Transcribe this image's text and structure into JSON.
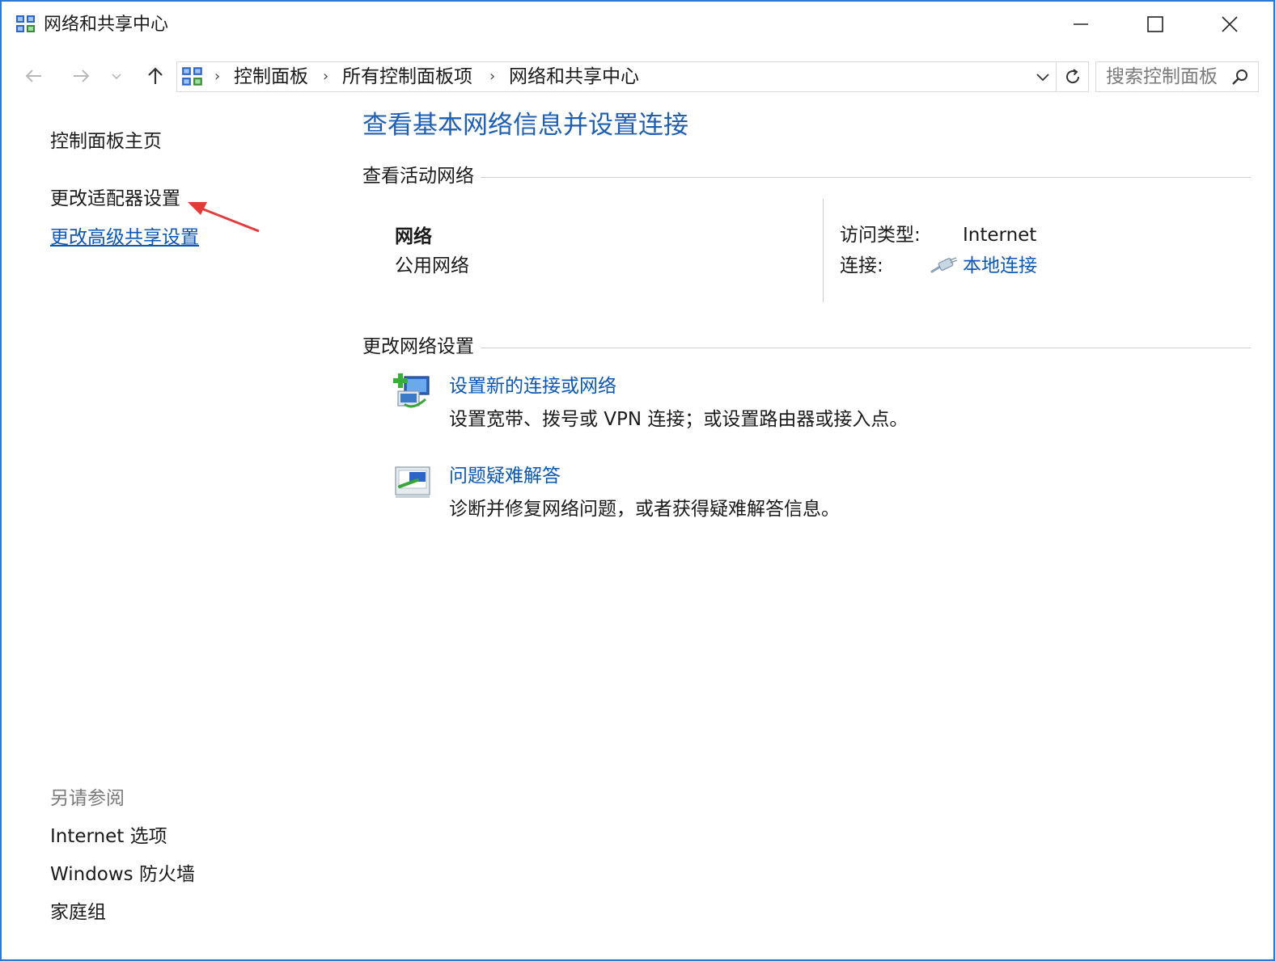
{
  "window": {
    "title": "网络和共享中心"
  },
  "address_bar": {
    "breadcrumbs": [
      "控制面板",
      "所有控制面板项",
      "网络和共享中心"
    ],
    "search_placeholder": "搜索控制面板"
  },
  "left_pane": {
    "links": [
      {
        "label": "控制面板主页",
        "style": "normal"
      },
      {
        "label": "更改适配器设置",
        "style": "normal"
      },
      {
        "label": "更改高级共享设置",
        "style": "link"
      }
    ],
    "see_also_title": "另请参阅",
    "see_also": [
      "Internet 选项",
      "Windows 防火墙",
      "家庭组"
    ]
  },
  "main": {
    "title": "查看基本网络信息并设置连接",
    "active_networks": {
      "heading": "查看活动网络",
      "network_name": "网络",
      "network_type": "公用网络",
      "access_type_label": "访问类型:",
      "access_type_value": "Internet",
      "connection_label": "连接:",
      "connection_value": "本地连接"
    },
    "change_settings": {
      "heading": "更改网络设置",
      "tasks": [
        {
          "link": "设置新的连接或网络",
          "description": "设置宽带、拨号或 VPN 连接；或设置路由器或接入点。",
          "icon": "new-connection-icon"
        },
        {
          "link": "问题疑难解答",
          "description": "诊断并修复网络问题，或者获得疑难解答信息。",
          "icon": "troubleshoot-icon"
        }
      ]
    }
  },
  "colors": {
    "link": "#0b57b6",
    "title": "#1e5fb4",
    "window_border": "#2b7ad6",
    "annotation_arrow": "#e23b3b"
  }
}
